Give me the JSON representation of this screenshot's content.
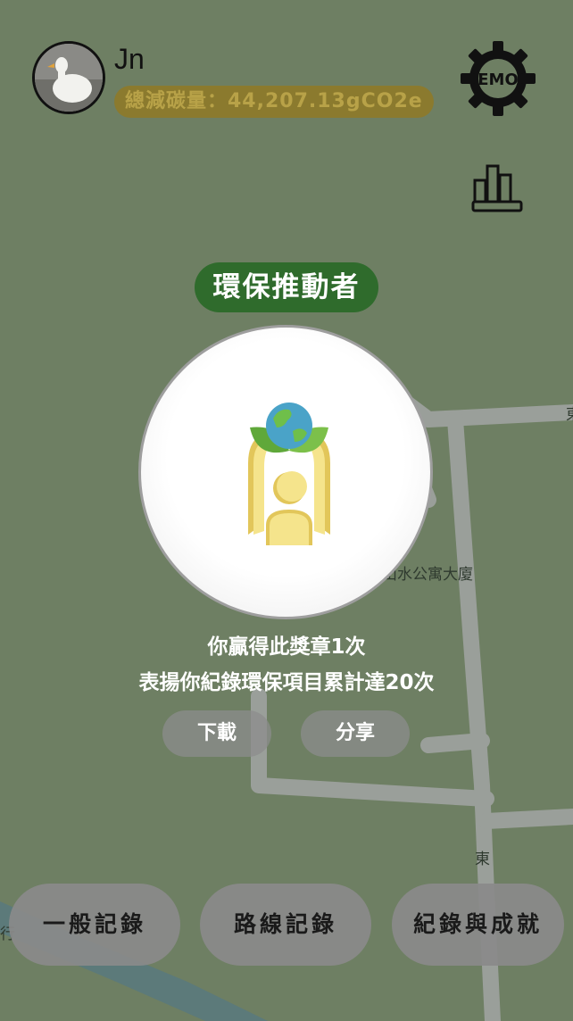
{
  "header": {
    "username": "Jn",
    "total_carbon": "總減碳量：44,207.13gCO2e",
    "settings_label": "EMO"
  },
  "map": {
    "place_label": "山水公寓大廈",
    "road_label_top": "東",
    "road_label_mid": "東",
    "road_label_left": "行"
  },
  "badge": {
    "title": "環保推動者",
    "earned_text": "你贏得此獎章1次",
    "description": "表揚你紀錄環保項目累計達20次",
    "download_label": "下載",
    "share_label": "分享"
  },
  "nav": {
    "general_record": "一般記錄",
    "route_record": "路線記錄",
    "records_achievements": "紀錄與成就"
  },
  "colors": {
    "map_bg": "#6e7f63",
    "badge_title_bg": "#2f6b2c",
    "carbon_pill_bg": "#8b7a2e"
  }
}
